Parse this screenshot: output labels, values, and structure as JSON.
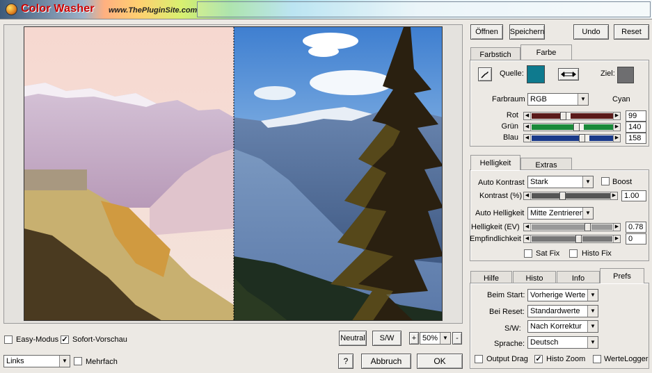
{
  "app": {
    "title": "Color Washer",
    "url": "www.ThePluginSite.com"
  },
  "toolbar": {
    "open": "Öffnen",
    "save": "Speichern",
    "undo": "Undo",
    "reset": "Reset"
  },
  "color_tabs": [
    {
      "label": "Farbstich"
    },
    {
      "label": "Farbe"
    }
  ],
  "color_panel": {
    "source_label": "Quelle:",
    "target_label": "Ziel:",
    "source_color": "#0e7a8e",
    "target_color": "#6e6e70",
    "colorspace_label": "Farbraum",
    "colorspace_value": "RGB",
    "color_name": "Cyan",
    "channels": [
      {
        "label": "Rot",
        "value": "99",
        "fraction": 0.39,
        "color": "#5a1a1a"
      },
      {
        "label": "Grün",
        "value": "140",
        "fraction": 0.55,
        "color": "#1a8a3a"
      },
      {
        "label": "Blau",
        "value": "158",
        "fraction": 0.62,
        "color": "#1a3a8a"
      }
    ]
  },
  "bright_tabs": [
    {
      "label": "Helligkeit"
    },
    {
      "label": "Extras"
    }
  ],
  "bright_panel": {
    "auto_contrast_label": "Auto Kontrast",
    "auto_contrast_value": "Stark",
    "boost_label": "Boost",
    "contrast_label": "Kontrast (%)",
    "contrast_value": "1.00",
    "auto_bright_label": "Auto Helligkeit",
    "auto_bright_value": "Mitte Zentrieren",
    "brightness_label": "Helligkeit (EV)",
    "brightness_value": "0.78",
    "sensitivity_label": "Empfindlichkeit",
    "sensitivity_value": "0",
    "satfix_label": "Sat Fix",
    "histofix_label": "Histo Fix"
  },
  "pref_tabs": [
    {
      "label": "Hilfe"
    },
    {
      "label": "Histo"
    },
    {
      "label": "Info"
    },
    {
      "label": "Prefs"
    }
  ],
  "prefs": {
    "start_label": "Beim Start:",
    "start_value": "Vorherige Werte",
    "reset_label": "Bei Reset:",
    "reset_value": "Standardwerte",
    "sw_label": "S/W:",
    "sw_value": "Nach Korrektur",
    "lang_label": "Sprache:",
    "lang_value": "Deutsch"
  },
  "bottom_options": {
    "output_drag": "Output Drag",
    "histo_zoom": "Histo Zoom",
    "werte_logger": "WerteLogger"
  },
  "preview_bar": {
    "easy_mode": "Easy-Modus",
    "live_preview": "Sofort-Vorschau",
    "neutral": "Neutral",
    "sw": "S/W",
    "plus": "+",
    "zoom": "50%",
    "minus": "-"
  },
  "footer": {
    "position_value": "Links",
    "multiple": "Mehrfach",
    "help": "?",
    "cancel": "Abbruch",
    "ok": "OK"
  }
}
